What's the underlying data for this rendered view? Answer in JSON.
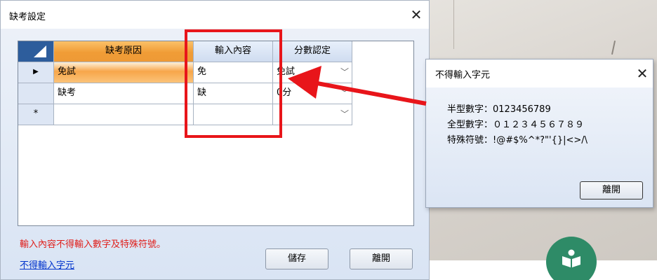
{
  "dialog": {
    "title": "缺考設定",
    "close": "✕",
    "columns": [
      "缺考原因",
      "輸入內容",
      "分數認定"
    ],
    "rows": [
      {
        "indicator": "▶",
        "reason": "免試",
        "input": "免",
        "score": "免試"
      },
      {
        "indicator": "",
        "reason": "缺考",
        "input": "缺",
        "score": "0分"
      },
      {
        "indicator": "*",
        "reason": "",
        "input": "",
        "score": ""
      }
    ],
    "warning": "輸入內容不得輸入數字及特殊符號。",
    "link": "不得輸入字元",
    "save_label": "儲存",
    "leave_label": "離開"
  },
  "popup": {
    "title": "不得輸入字元",
    "close": "✕",
    "lines": [
      "半型數字：0123456789",
      "全型數字：０１２３４５６７８９",
      "特殊符號：!@#$%^*?\"'{}|<>/\\"
    ],
    "leave_label": "離開"
  },
  "annotation": {
    "color": "#e8151a"
  },
  "background": {
    "icon": "book-icon",
    "accent": "#2e8b67"
  }
}
